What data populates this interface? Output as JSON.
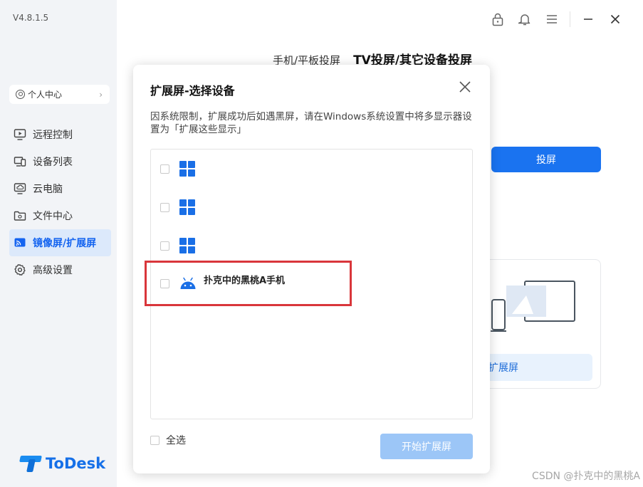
{
  "app": {
    "version": "V4.8.1.5",
    "brand": "ToDesk"
  },
  "sidebar": {
    "user_center_label": "个人中心",
    "items": [
      {
        "label": "远程控制",
        "icon": "monitor-play-icon",
        "active": false
      },
      {
        "label": "设备列表",
        "icon": "devices-icon",
        "active": false
      },
      {
        "label": "云电脑",
        "icon": "cloud-pc-icon",
        "active": false
      },
      {
        "label": "文件中心",
        "icon": "folder-icon",
        "active": false
      },
      {
        "label": "镜像屏/扩展屏",
        "icon": "cast-icon",
        "active": true
      },
      {
        "label": "高级设置",
        "icon": "gear-icon",
        "active": false
      }
    ]
  },
  "main": {
    "tabs": [
      {
        "label": "手机/平板投屏",
        "active": false
      },
      {
        "label": "TV投屏/其它设备投屏",
        "active": true
      }
    ],
    "cast_button": "投屏",
    "card_button": "扩展屏"
  },
  "dialog": {
    "title": "扩展屏-选择设备",
    "description": "因系统限制，扩展成功后如遇黑屏，请在Windows系统设置中将多显示器设置为「扩展这些显示」",
    "devices": [
      {
        "type": "windows",
        "name": "",
        "checked": false
      },
      {
        "type": "windows",
        "name": "",
        "checked": false
      },
      {
        "type": "windows",
        "name": "",
        "checked": false
      },
      {
        "type": "android",
        "name": "扑克中的黑桃A手机",
        "checked": false
      }
    ],
    "select_all_label": "全选",
    "start_button": "开始扩展屏"
  },
  "watermark": "CSDN @扑克中的黑桃A",
  "colors": {
    "accent": "#1a73f0",
    "sidebar_bg": "#f2f4f7",
    "active_nav_bg": "#dce9fb",
    "highlight_border": "#d9363b",
    "disabled_button": "#9cc6f7"
  }
}
